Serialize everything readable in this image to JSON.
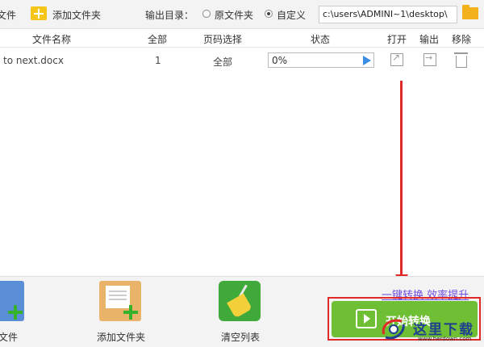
{
  "toolbar": {
    "add_file_label": "文件",
    "add_folder_label": "添加文件夹",
    "output_dir_label": "输出目录：",
    "option_original": "原文件夹",
    "option_custom": "自定义",
    "selected_option": "自定义",
    "output_path": "c:\\users\\ADMINI~1\\desktop\\"
  },
  "table": {
    "columns": [
      "文件名称",
      "全部",
      "页码选择",
      "状态",
      "打开",
      "输出",
      "移除"
    ],
    "rows": [
      {
        "name": "to next.docx",
        "total": "1",
        "pages": "全部",
        "status": "0%",
        "progress": 0
      }
    ]
  },
  "bottom": {
    "add_file_label": "文件",
    "add_folder_label": "添加文件夹",
    "clear_label": "清空列表",
    "slogan": "一键转换  效率提升",
    "convert_label": "开始转换",
    "watermark_text": "这里下载",
    "watermark_sub": "www.herdown.com"
  },
  "colors": {
    "accent_green": "#6fbf34",
    "highlight_red": "#e02a2a",
    "slogan_purple": "#6c4ee0",
    "progress_blue": "#3a8ee6"
  }
}
